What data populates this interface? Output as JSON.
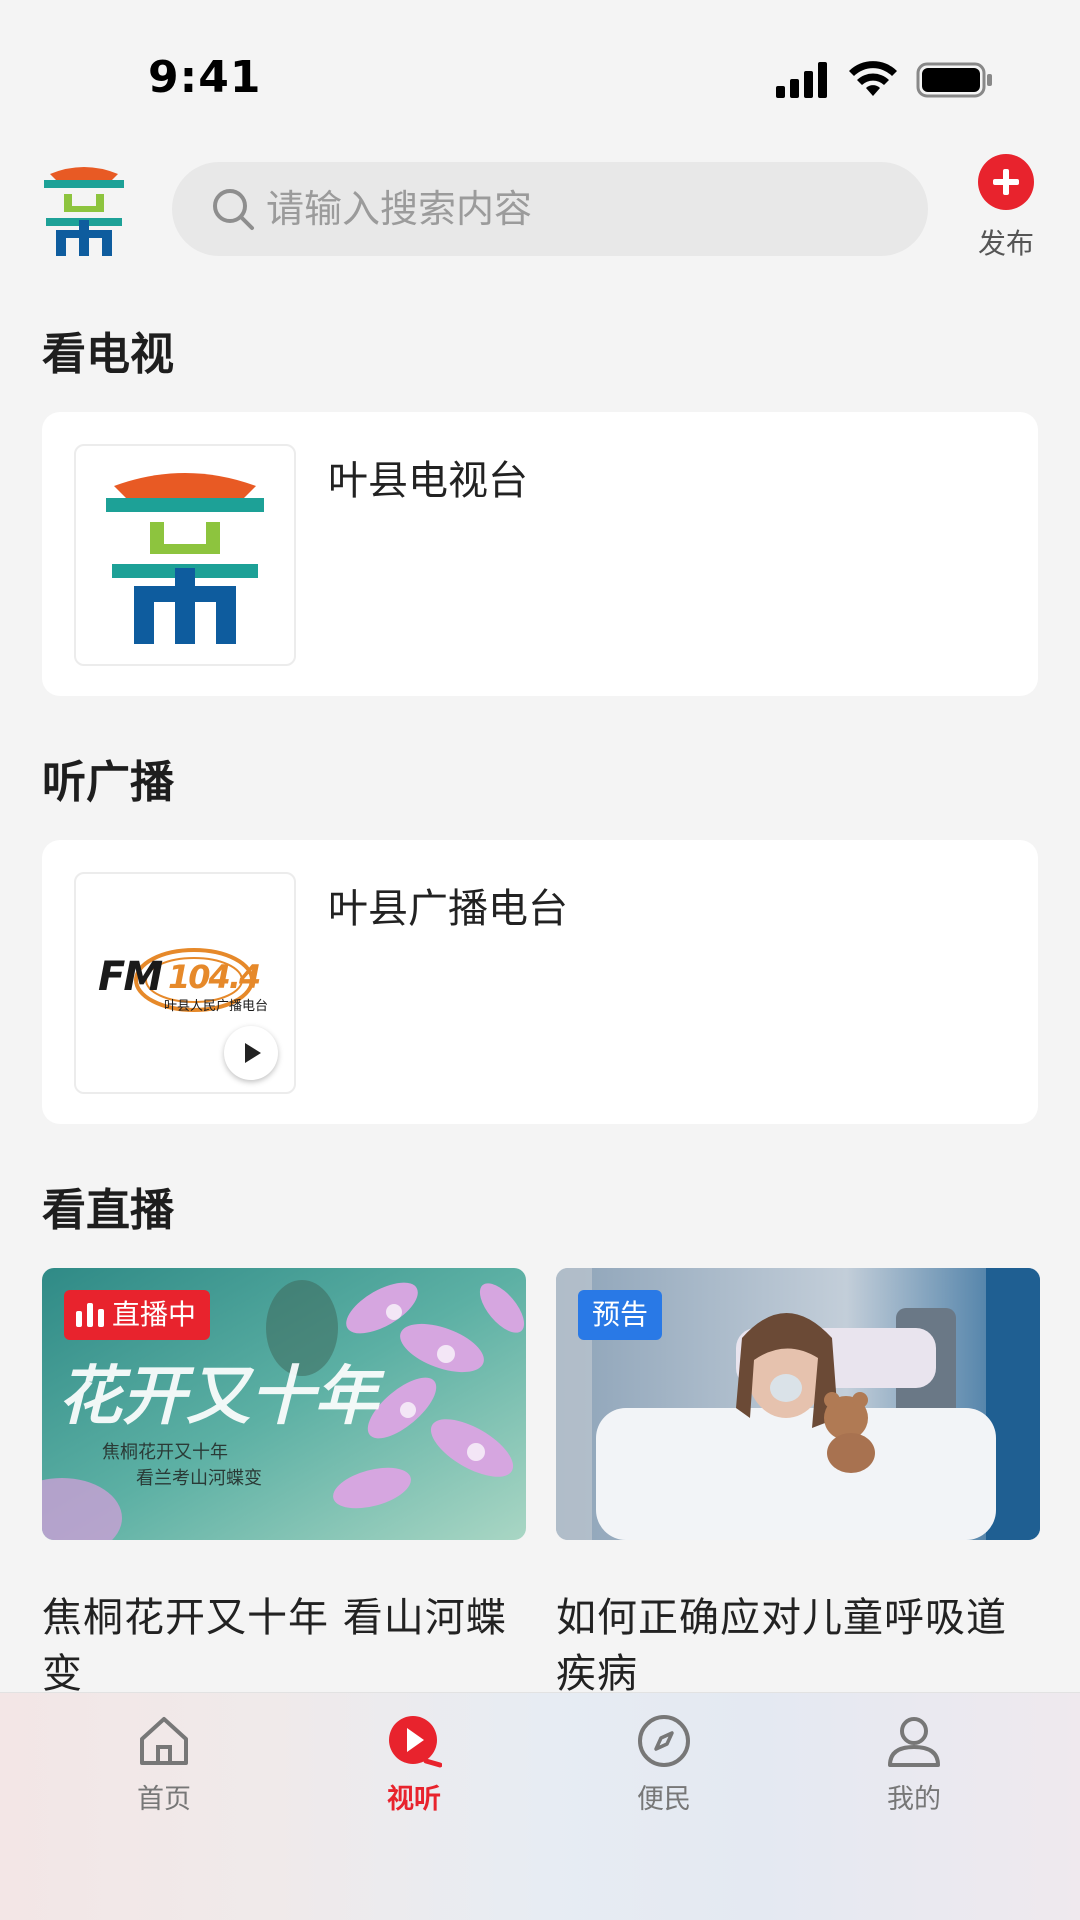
{
  "status_bar": {
    "time": "9:41"
  },
  "header": {
    "search_placeholder": "请输入搜索内容",
    "publish_label": "发布"
  },
  "sections": {
    "tv": {
      "title": "看电视",
      "channel": "叶县电视台"
    },
    "radio": {
      "title": "听广播",
      "channel": "叶县广播电台",
      "logo_text": "FM104.4",
      "logo_subtext": "叶县人民广播电台"
    },
    "live": {
      "title": "看直播",
      "items": [
        {
          "badge": "直播中",
          "title": "焦桐花开又十年 看山河蝶变",
          "poster_text": "花开又十年",
          "poster_sub1": "焦桐花开又十年",
          "poster_sub2": "看兰考山河蝶变"
        },
        {
          "badge": "预告",
          "title": "如何正确应对儿童呼吸道疾病"
        }
      ]
    }
  },
  "tabbar": {
    "items": [
      {
        "label": "首页",
        "icon": "home-icon"
      },
      {
        "label": "视听",
        "icon": "play-icon",
        "active": true
      },
      {
        "label": "便民",
        "icon": "compass-icon"
      },
      {
        "label": "我的",
        "icon": "user-icon"
      }
    ]
  },
  "colors": {
    "accent": "#e8232d",
    "preview_badge": "#2979e6",
    "background": "#f4f4f4"
  }
}
